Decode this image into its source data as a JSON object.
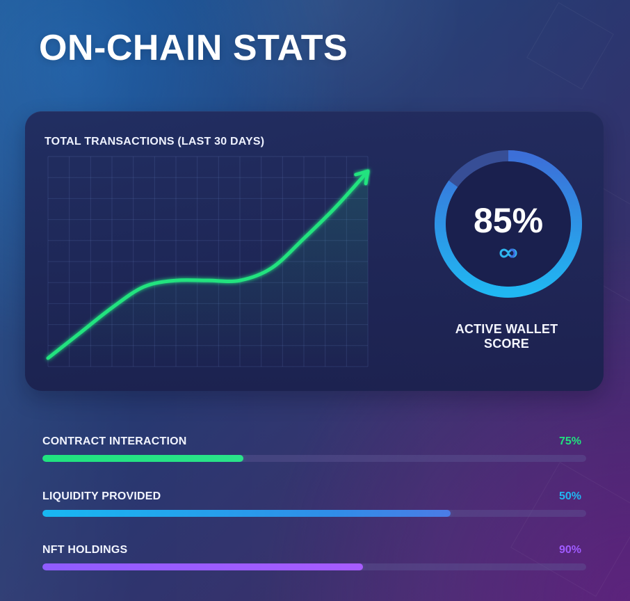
{
  "page": {
    "title": "ON-CHAIN STATS"
  },
  "colors": {
    "green": "#20e37f",
    "blue": "#20b7f2",
    "blue_dark": "#3c6fd8",
    "purple": "#a05bff",
    "card": "#212a5c"
  },
  "icons": {
    "score_icon": "link-icon"
  },
  "chart_section": {
    "title": "TOTAL TRANSACTIONS (LAST 30 DAYS)"
  },
  "score_section": {
    "value": "85%",
    "label": "ACTIVE WALLET SCORE",
    "progress_percent": 85
  },
  "metrics": [
    {
      "label": "CONTRACT INTERACTION",
      "value_text": "75%",
      "fill_percent": 37,
      "color": "#20e37f"
    },
    {
      "label": "LIQUIDITY PROVIDED",
      "value_text": "50%",
      "fill_percent": 75,
      "color": "#20b7f2"
    },
    {
      "label": "NFT HOLDINGS",
      "value_text": "90%",
      "fill_percent": 59,
      "color": "#a05bff"
    }
  ],
  "chart_data": {
    "type": "line",
    "title": "TOTAL TRANSACTIONS (LAST 30 DAYS)",
    "xlabel": "",
    "ylabel": "",
    "x": [
      0,
      3,
      6,
      9,
      12,
      15,
      18,
      21,
      24,
      27,
      30
    ],
    "xlim": [
      0,
      30
    ],
    "ylim": [
      0,
      10
    ],
    "grid": true,
    "legend": "none",
    "series": [
      {
        "values": [
          0.4,
          1.6,
          2.8,
          3.8,
          4.1,
          4.1,
          4.1,
          4.7,
          6.1,
          7.6,
          9.3
        ],
        "color": "#20e37f"
      }
    ]
  }
}
